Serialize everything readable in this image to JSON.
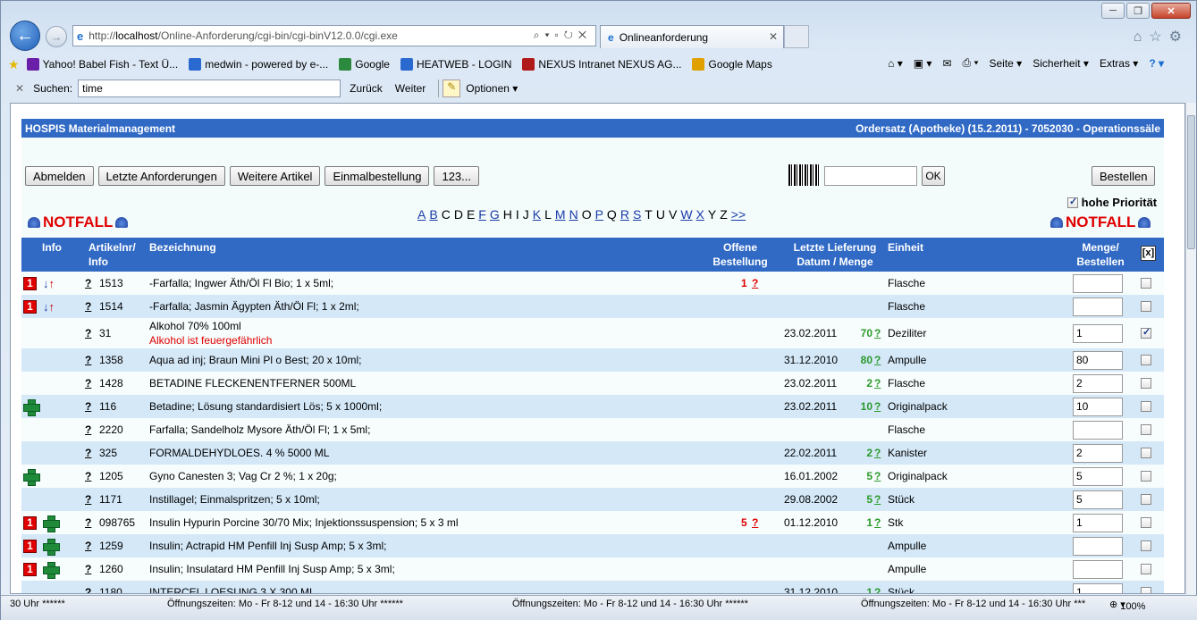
{
  "browser": {
    "address_prefix": "http://",
    "address_host": "localhost",
    "address_path": "/Online-Anforderung/cgi-bin/cgi-binV12.0.0/cgi.exe",
    "tab_title": "Onlineanforderung",
    "favorites": [
      {
        "label": "Yahoo! Babel Fish - Text Ü...",
        "color": "#6b1ea8"
      },
      {
        "label": "medwin - powered by e-...",
        "color": "#2a6ad0"
      },
      {
        "label": "Google",
        "color": "#2b8a3e"
      },
      {
        "label": "HEATWEB - LOGIN",
        "color": "#2a6ad0"
      },
      {
        "label": "NEXUS Intranet NEXUS AG...",
        "color": "#b01a1a"
      },
      {
        "label": "Google Maps",
        "color": "#e0a000"
      }
    ],
    "toolbar_right": [
      "Seite ▾",
      "Sicherheit ▾",
      "Extras ▾"
    ],
    "find": {
      "label": "Suchen:",
      "value": "time",
      "prev": "Zurück",
      "next": "Weiter",
      "options": "Optionen"
    },
    "status": [
      "30 Uhr ******",
      "Öffnungszeiten: Mo - Fr 8-12 und 14 - 16:30 Uhr ******",
      "Öffnungszeiten: Mo - Fr 8-12 und 14 - 16:30 Uhr ******",
      "Öffnungszeiten: Mo - Fr 8-12 und 14 - 16:30 Uhr ***"
    ],
    "zoom": "100%"
  },
  "page": {
    "header_left": "HOSPIS Materialmanagement",
    "header_right": "Ordersatz (Apotheke) (15.2.2011) - 7052030 - Operationssäle",
    "buttons": [
      "Abmelden",
      "Letzte Anforderungen",
      "Weitere Artikel",
      "Einmalbestellung",
      "123..."
    ],
    "ok": "OK",
    "order": "Bestellen",
    "priority": "hohe Priorität",
    "notfall": "NOTFALL",
    "letters": [
      {
        "l": "A",
        "link": true
      },
      {
        "l": "B",
        "link": true
      },
      {
        "l": "C",
        "link": false
      },
      {
        "l": "D",
        "link": false
      },
      {
        "l": "E",
        "link": false
      },
      {
        "l": "F",
        "link": true
      },
      {
        "l": "G",
        "link": true
      },
      {
        "l": "H",
        "link": false
      },
      {
        "l": "I",
        "link": false
      },
      {
        "l": "J",
        "link": false
      },
      {
        "l": "K",
        "link": true
      },
      {
        "l": "L",
        "link": false
      },
      {
        "l": "M",
        "link": true
      },
      {
        "l": "N",
        "link": true
      },
      {
        "l": "O",
        "link": false
      },
      {
        "l": "P",
        "link": true
      },
      {
        "l": "Q",
        "link": false
      },
      {
        "l": "R",
        "link": true
      },
      {
        "l": "S",
        "link": true
      },
      {
        "l": "T",
        "link": false
      },
      {
        "l": "U",
        "link": false
      },
      {
        "l": "V",
        "link": false
      },
      {
        "l": "W",
        "link": true
      },
      {
        "l": "X",
        "link": true
      },
      {
        "l": "Y",
        "link": false
      },
      {
        "l": "Z",
        "link": false
      },
      {
        "l": ">>",
        "link": true
      }
    ]
  },
  "table": {
    "headers": {
      "info": "Info",
      "artikel1": "Artikelnr/",
      "artikel2": "Info",
      "bezeichnung": "Bezeichnung",
      "offene1": "Offene",
      "offene2": "Bestellung",
      "lieferung1": "Letzte Lieferung",
      "lieferung2": "Datum / Menge",
      "einheit": "Einheit",
      "menge1": "Menge/",
      "menge2": "Bestellen",
      "close": "[x]"
    },
    "rows": [
      {
        "red": true,
        "arrows": true,
        "cross": false,
        "nr": "1513",
        "name": "-Farfalla; Ingwer Äth/Öl Fl Bio; 1 x 5ml;",
        "warn": "",
        "open": "1",
        "date": "",
        "qty": "",
        "unit": "Flasche",
        "menge": "",
        "checked": false
      },
      {
        "red": true,
        "arrows": true,
        "cross": false,
        "nr": "1514",
        "name": "-Farfalla; Jasmin Ägypten Äth/Öl Fl; 1 x 2ml;",
        "warn": "",
        "open": "",
        "date": "",
        "qty": "",
        "unit": "Flasche",
        "menge": "",
        "checked": false
      },
      {
        "red": false,
        "arrows": false,
        "cross": false,
        "nr": "31",
        "name": "Alkohol 70% 100ml",
        "warn": "Alkohol ist feuergefährlich",
        "open": "",
        "date": "23.02.2011",
        "qty": "70",
        "unit": "Deziliter",
        "menge": "1",
        "checked": true
      },
      {
        "red": false,
        "arrows": false,
        "cross": false,
        "nr": "1358",
        "name": "Aqua ad inj; Braun Mini Pl o Best; 20 x 10ml;",
        "warn": "",
        "open": "",
        "date": "31.12.2010",
        "qty": "80",
        "unit": "Ampulle",
        "menge": "80",
        "checked": false
      },
      {
        "red": false,
        "arrows": false,
        "cross": false,
        "nr": "1428",
        "name": "BETADINE FLECKENENTFERNER 500ML",
        "warn": "",
        "open": "",
        "date": "23.02.2011",
        "qty": "2",
        "unit": "Flasche",
        "menge": "2",
        "checked": false
      },
      {
        "red": false,
        "arrows": false,
        "cross": true,
        "nr": "116",
        "name": "Betadine; Lösung standardisiert Lös; 5 x 1000ml;",
        "warn": "",
        "open": "",
        "date": "23.02.2011",
        "qty": "10",
        "unit": "Originalpack",
        "menge": "10",
        "checked": false
      },
      {
        "red": false,
        "arrows": false,
        "cross": false,
        "nr": "2220",
        "name": "Farfalla; Sandelholz Mysore Äth/Öl Fl; 1 x 5ml;",
        "warn": "",
        "open": "",
        "date": "",
        "qty": "",
        "unit": "Flasche",
        "menge": "",
        "checked": false
      },
      {
        "red": false,
        "arrows": false,
        "cross": false,
        "nr": "325",
        "name": "FORMALDEHYDLOES. 4 % 5000 ML",
        "warn": "",
        "open": "",
        "date": "22.02.2011",
        "qty": "2",
        "unit": "Kanister",
        "menge": "2",
        "checked": false
      },
      {
        "red": false,
        "arrows": false,
        "cross": true,
        "nr": "1205",
        "name": "Gyno Canesten 3; Vag Cr 2 %; 1 x 20g;",
        "warn": "",
        "open": "",
        "date": "16.01.2002",
        "qty": "5",
        "unit": "Originalpack",
        "menge": "5",
        "checked": false
      },
      {
        "red": false,
        "arrows": false,
        "cross": false,
        "nr": "1171",
        "name": "Instillagel; Einmalspritzen; 5 x 10ml;",
        "warn": "",
        "open": "",
        "date": "29.08.2002",
        "qty": "5",
        "unit": "Stück",
        "menge": "5",
        "checked": false
      },
      {
        "red": true,
        "arrows": false,
        "cross": true,
        "nr": "098765",
        "name": "Insulin Hypurin Porcine 30/70 Mix; Injektionssuspension; 5 x 3 ml",
        "warn": "",
        "open": "5",
        "date": "01.12.2010",
        "qty": "1",
        "unit": "Stk",
        "menge": "1",
        "checked": false
      },
      {
        "red": true,
        "arrows": false,
        "cross": true,
        "nr": "1259",
        "name": "Insulin; Actrapid HM Penfill Inj Susp Amp; 5 x 3ml;",
        "warn": "",
        "open": "",
        "date": "",
        "qty": "",
        "unit": "Ampulle",
        "menge": "",
        "checked": false
      },
      {
        "red": true,
        "arrows": false,
        "cross": true,
        "nr": "1260",
        "name": "Insulin; Insulatard HM Penfill Inj Susp Amp; 5 x 3ml;",
        "warn": "",
        "open": "",
        "date": "",
        "qty": "",
        "unit": "Ampulle",
        "menge": "",
        "checked": false
      },
      {
        "red": false,
        "arrows": false,
        "cross": false,
        "nr": "1180",
        "name": "INTERCEL LOESUNG 3 X 300 ML",
        "warn": "",
        "open": "",
        "date": "31.12.2010",
        "qty": "1",
        "unit": "Stück",
        "menge": "1",
        "checked": false
      }
    ]
  },
  "colors": {
    "header_blue": "#316ac5",
    "row_blue": "#d4e8f8",
    "red": "#e00000",
    "green": "#2a9a2a"
  },
  "icons": [
    "back-arrow-icon",
    "forward-arrow-icon",
    "ie-logo-icon",
    "home-icon",
    "star-icon",
    "gear-icon",
    "barcode-icon",
    "siren-icon",
    "green-cross-icon",
    "priority-one-icon",
    "transfer-arrows-icon"
  ]
}
